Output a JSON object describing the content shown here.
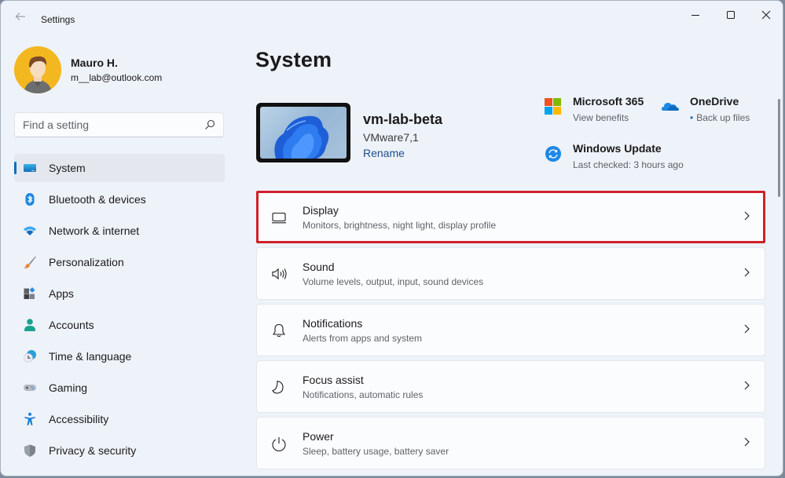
{
  "window": {
    "app_title": "Settings",
    "controls": {
      "minimize": "Minimize",
      "maximize": "Maximize",
      "close": "Close"
    }
  },
  "profile": {
    "name": "Mauro H.",
    "email": "m__lab@outlook.com"
  },
  "search": {
    "placeholder": "Find a setting",
    "value": ""
  },
  "sidebar": {
    "items": [
      {
        "label": "System",
        "icon": "system-icon",
        "active": true
      },
      {
        "label": "Bluetooth & devices",
        "icon": "bluetooth-icon"
      },
      {
        "label": "Network & internet",
        "icon": "wifi-icon"
      },
      {
        "label": "Personalization",
        "icon": "brush-icon"
      },
      {
        "label": "Apps",
        "icon": "apps-icon"
      },
      {
        "label": "Accounts",
        "icon": "accounts-icon"
      },
      {
        "label": "Time & language",
        "icon": "clock-globe-icon"
      },
      {
        "label": "Gaming",
        "icon": "gamepad-icon"
      },
      {
        "label": "Accessibility",
        "icon": "accessibility-icon"
      },
      {
        "label": "Privacy & security",
        "icon": "shield-icon"
      }
    ]
  },
  "main": {
    "title": "System",
    "device": {
      "name": "vm-lab-beta",
      "model": "VMware7,1",
      "rename_label": "Rename"
    },
    "quick_links": {
      "m365": {
        "title": "Microsoft 365",
        "subtitle": "View benefits"
      },
      "onedrive": {
        "title": "OneDrive",
        "subtitle": "Back up files"
      },
      "windows_update": {
        "title": "Windows Update",
        "subtitle": "Last checked: 3 hours ago"
      }
    },
    "cards": [
      {
        "title": "Display",
        "subtitle": "Monitors, brightness, night light, display profile",
        "icon": "display-icon",
        "highlighted": true
      },
      {
        "title": "Sound",
        "subtitle": "Volume levels, output, input, sound devices",
        "icon": "speaker-icon"
      },
      {
        "title": "Notifications",
        "subtitle": "Alerts from apps and system",
        "icon": "bell-icon"
      },
      {
        "title": "Focus assist",
        "subtitle": "Notifications, automatic rules",
        "icon": "moon-icon"
      },
      {
        "title": "Power",
        "subtitle": "Sleep, battery usage, battery saver",
        "icon": "power-icon"
      }
    ]
  },
  "colors": {
    "accent": "#0f6cbd",
    "highlight_border": "#d0202a",
    "background": "#eef2f9"
  }
}
